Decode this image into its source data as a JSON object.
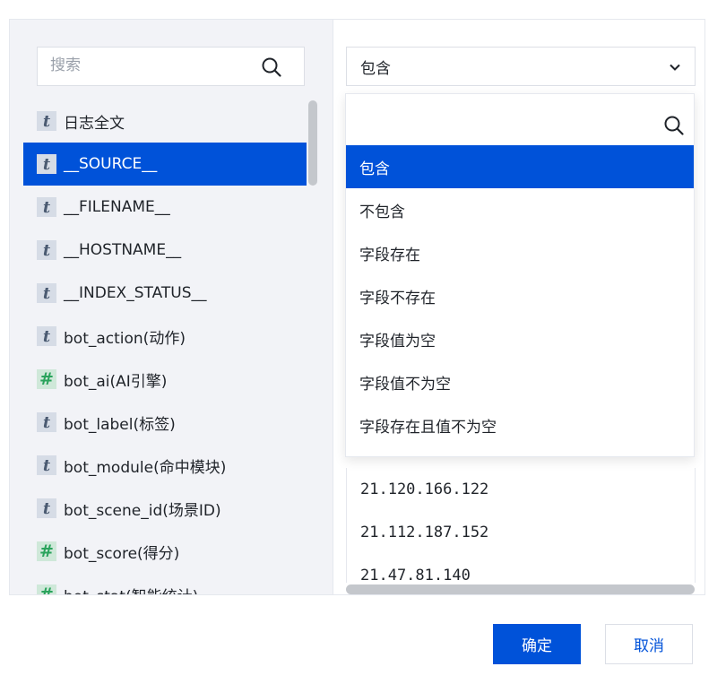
{
  "left_panel": {
    "search_placeholder": "搜索",
    "fields": [
      {
        "type": "t",
        "label": "日志全文",
        "selected": false
      },
      {
        "type": "t",
        "label": "__SOURCE__",
        "selected": true
      },
      {
        "type": "t",
        "label": "__FILENAME__",
        "selected": false
      },
      {
        "type": "t",
        "label": "__HOSTNAME__",
        "selected": false
      },
      {
        "type": "t",
        "label": "__INDEX_STATUS__",
        "selected": false
      },
      {
        "type": "t",
        "label": "bot_action(动作)",
        "selected": false
      },
      {
        "type": "#",
        "label": "bot_ai(AI引擎)",
        "selected": false
      },
      {
        "type": "t",
        "label": "bot_label(标签)",
        "selected": false
      },
      {
        "type": "t",
        "label": "bot_module(命中模块)",
        "selected": false
      },
      {
        "type": "t",
        "label": "bot_scene_id(场景ID)",
        "selected": false
      },
      {
        "type": "#",
        "label": "bot_score(得分)",
        "selected": false
      },
      {
        "type": "#",
        "label": "bot_stat(智能统计)",
        "selected": false
      }
    ]
  },
  "right_panel": {
    "operator_select": {
      "value": "包含"
    },
    "values": [
      "21.120.166.122",
      "21.112.187.152",
      "21.47.81.140"
    ]
  },
  "dropdown": {
    "search_value": "",
    "options": [
      {
        "label": "包含",
        "active": true
      },
      {
        "label": "不包含",
        "active": false
      },
      {
        "label": "字段存在",
        "active": false
      },
      {
        "label": "字段不存在",
        "active": false
      },
      {
        "label": "字段值为空",
        "active": false
      },
      {
        "label": "字段值不为空",
        "active": false
      },
      {
        "label": "字段存在且值不为空",
        "active": false
      }
    ]
  },
  "footer": {
    "confirm_label": "确定",
    "cancel_label": "取消"
  },
  "colors": {
    "accent": "#0052d9",
    "panel_bg": "#f2f3f7",
    "badge_t": "#d6dce6",
    "badge_num": "#cfe8d9"
  },
  "icons": {
    "search": "search-icon",
    "chevron": "chevron-down-icon",
    "text_type": "t",
    "number_type": "#"
  }
}
